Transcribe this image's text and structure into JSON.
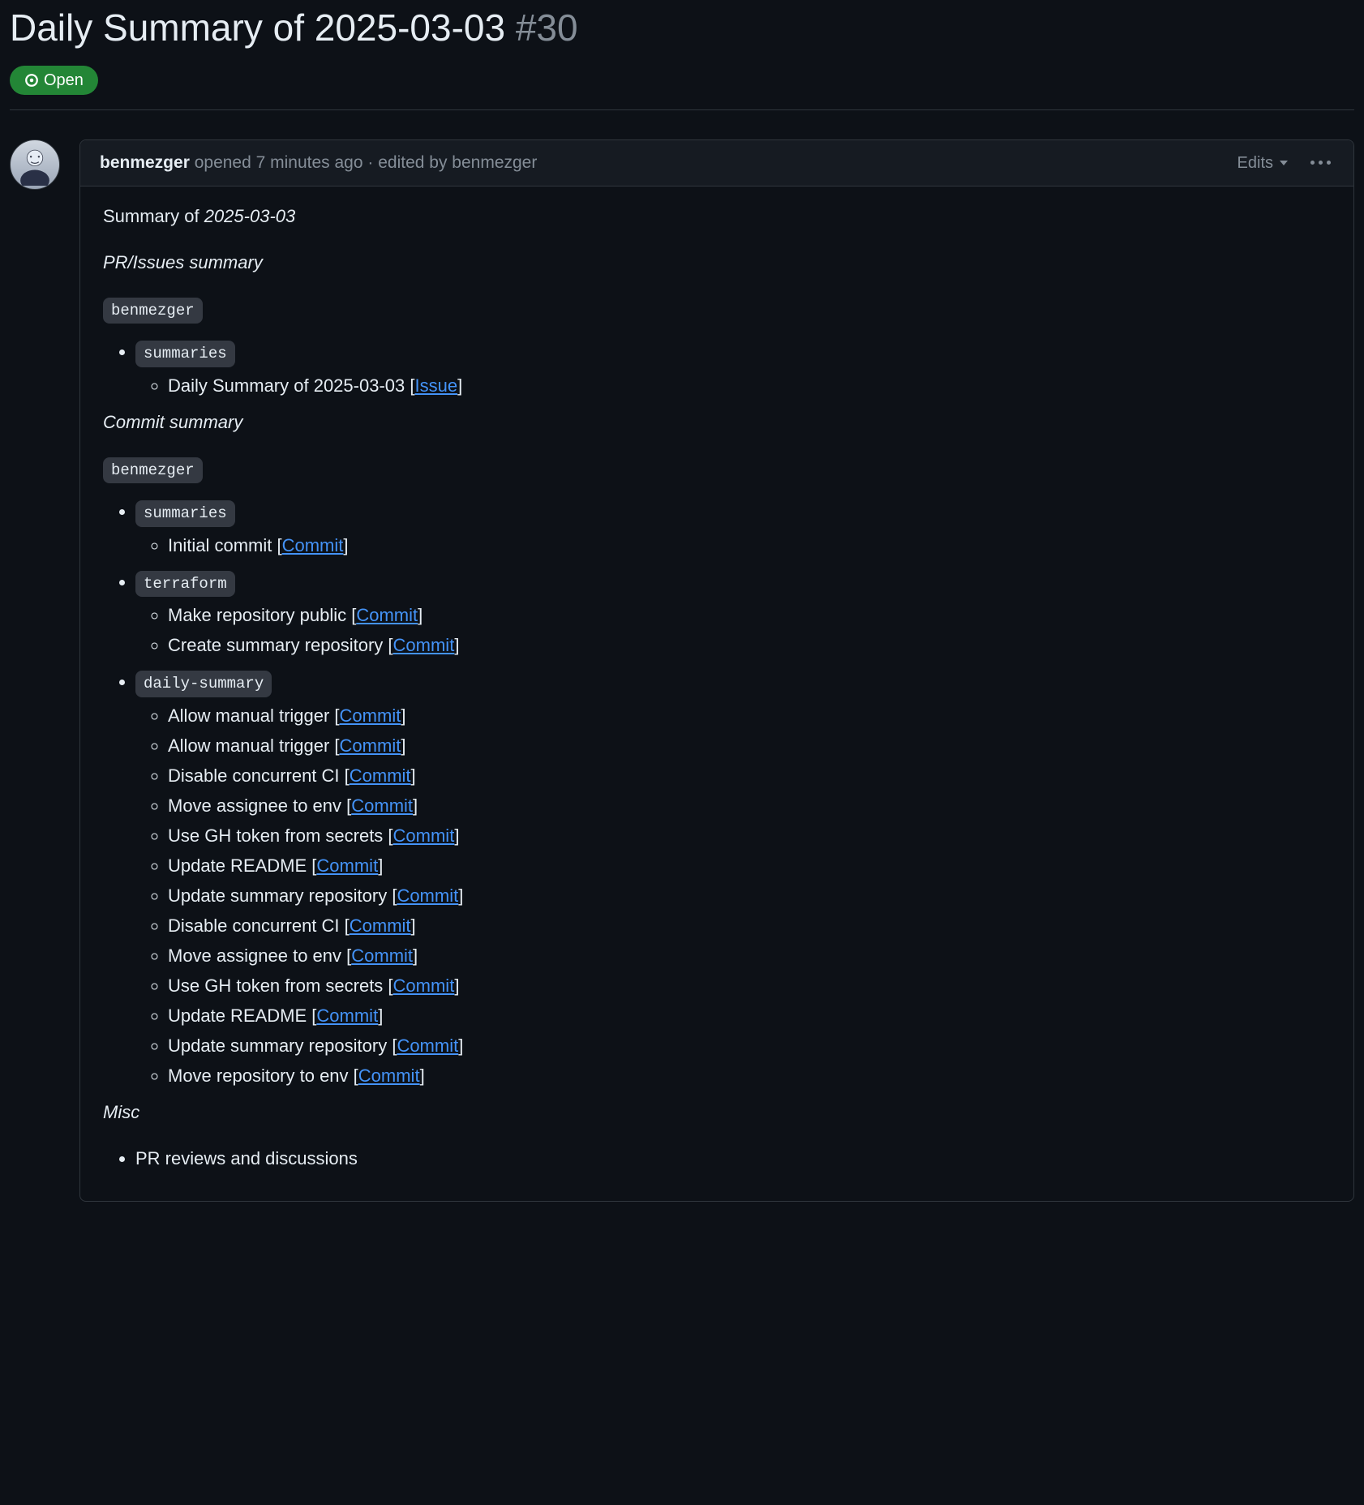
{
  "issue": {
    "title": "Daily Summary of 2025-03-03",
    "number": "#30",
    "state_label": "Open"
  },
  "comment": {
    "author": "benmezger",
    "opened": "opened 7 minutes ago",
    "sep": " · ",
    "edited_prefix": "edited by ",
    "editor": "benmezger",
    "edits_label": "Edits"
  },
  "body": {
    "summary_prefix": "Summary of ",
    "summary_date": "2025-03-03",
    "section_pr": "PR/Issues summary",
    "user_chip": "benmezger",
    "issue_link_label": "Issue",
    "commit_link_label": "Commit",
    "section_commit": "Commit summary",
    "misc_heading": "Misc",
    "pr_groups": [
      {
        "chip": "summaries",
        "items": [
          {
            "text": "Daily Summary of 2025-03-03",
            "type": "issue"
          }
        ]
      }
    ],
    "commit_groups": [
      {
        "chip": "summaries",
        "spaced": true,
        "items": [
          {
            "text": "Initial commit"
          }
        ]
      },
      {
        "chip": "terraform",
        "spaced": true,
        "items": [
          {
            "text": "Make repository public"
          },
          {
            "text": "Create summary repository"
          }
        ]
      },
      {
        "chip": "daily-summary",
        "spaced": true,
        "items": [
          {
            "text": "Allow manual trigger"
          },
          {
            "text": "Allow manual trigger"
          },
          {
            "text": "Disable concurrent CI"
          },
          {
            "text": "Move assignee to env"
          },
          {
            "text": "Use GH token from secrets"
          },
          {
            "text": "Update README"
          },
          {
            "text": "Update summary repository"
          },
          {
            "text": "Disable concurrent CI"
          },
          {
            "text": "Move assignee to env"
          },
          {
            "text": "Use GH token from secrets"
          },
          {
            "text": "Update README"
          },
          {
            "text": "Update summary repository"
          },
          {
            "text": "Move repository to env"
          }
        ]
      }
    ],
    "misc_items": [
      "PR reviews and discussions"
    ]
  }
}
